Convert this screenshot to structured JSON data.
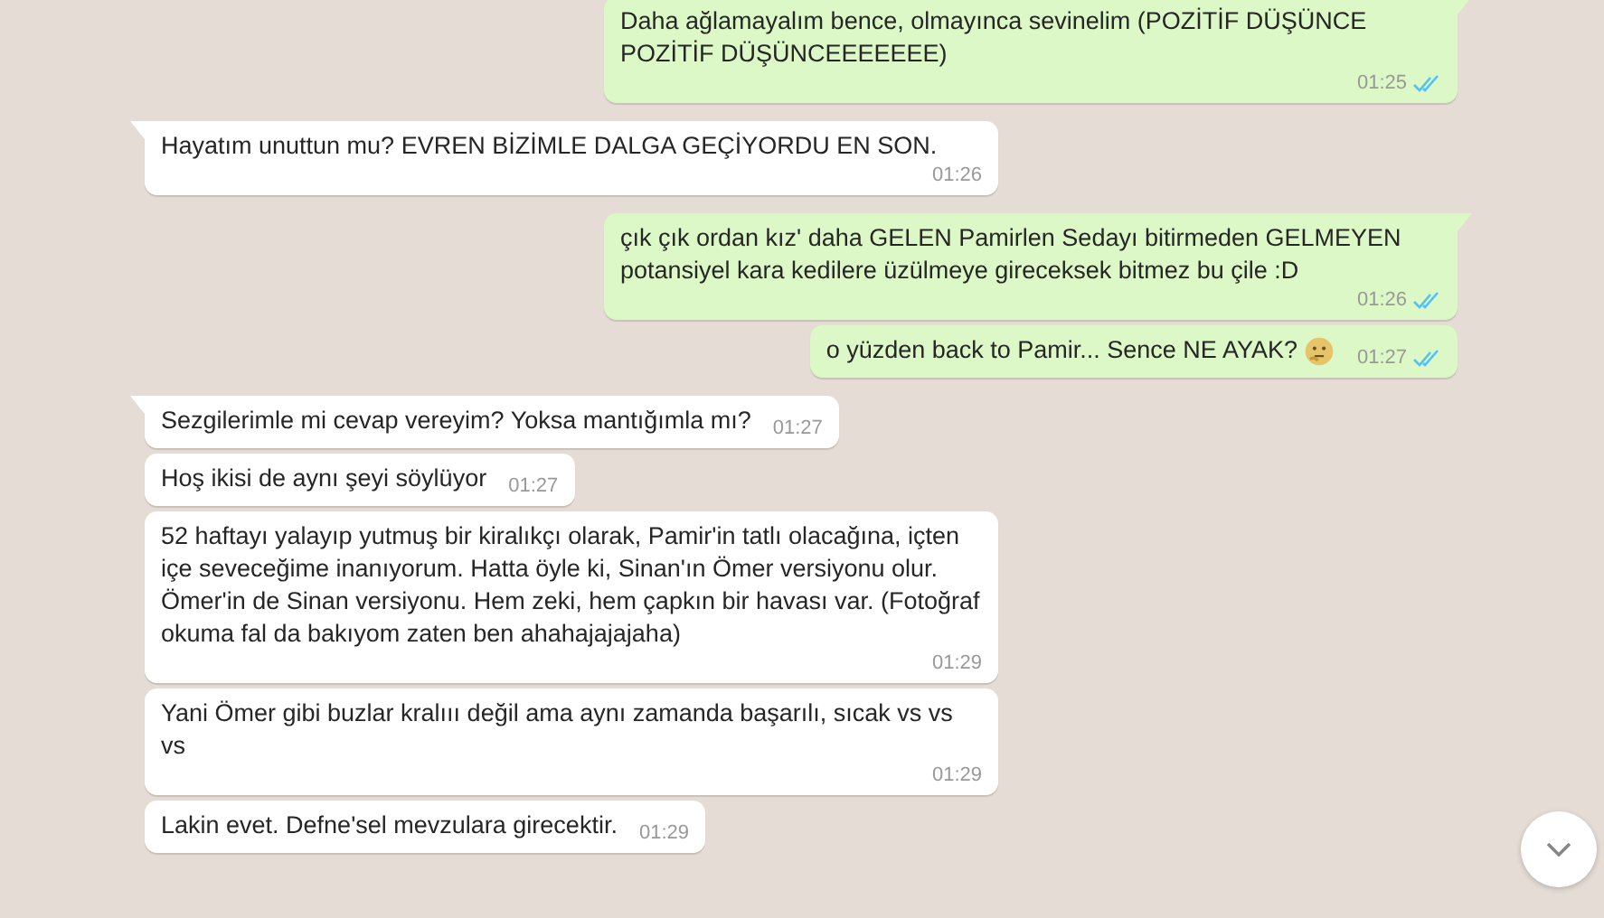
{
  "messages": [
    {
      "kind": "outgoing",
      "text": "Daha ağlamayalım bence, olmayınca sevinelim (POZİTİF DÜŞÜNCE POZİTİF DÜŞÜNCEEEEEEE)",
      "time": "01:25",
      "read": true
    },
    {
      "kind": "incoming",
      "text": "Hayatım unuttun mu? EVREN BİZİMLE DALGA GEÇİYORDU EN SON.",
      "time": "01:26"
    },
    {
      "kind": "outgoing",
      "text": "çık çık ordan kız' daha GELEN Pamirlen Sedayı bitirmeden GELMEYEN potansiyel kara kedilere üzülmeye gireceksek bitmez bu çile :D",
      "time": "01:26",
      "read": true
    },
    {
      "kind": "outgoing",
      "text": "o yüzden back to Pamir... Sence NE AYAK?",
      "thinking_emoji": true,
      "time": "01:27",
      "read": true
    },
    {
      "kind": "incoming",
      "text": "Sezgilerimle mi cevap vereyim? Yoksa mantığımla mı?",
      "time": "01:27"
    },
    {
      "kind": "incoming",
      "text": "Hoş ikisi de aynı şeyi söylüyor",
      "time": "01:27"
    },
    {
      "kind": "incoming",
      "text": "52 haftayı yalayıp yutmuş bir kiralıkçı olarak, Pamir'in tatlı olacağına, içten içe seveceğime inanıyorum. Hatta öyle ki, Sinan'ın Ömer versiyonu olur. Ömer'in de Sinan versiyonu. Hem zeki, hem çapkın bir havası var. (Fotoğraf okuma fal da bakıyom zaten ben ahahajajajaha)",
      "time": "01:29"
    },
    {
      "kind": "incoming",
      "text": "Yani Ömer gibi buzlar kralııı değil ama aynı zamanda başarılı, sıcak vs vs vs",
      "time": "01:29"
    },
    {
      "kind": "incoming",
      "text": "Lakin evet. Defne'sel mevzulara girecektir.",
      "time": "01:29"
    }
  ]
}
